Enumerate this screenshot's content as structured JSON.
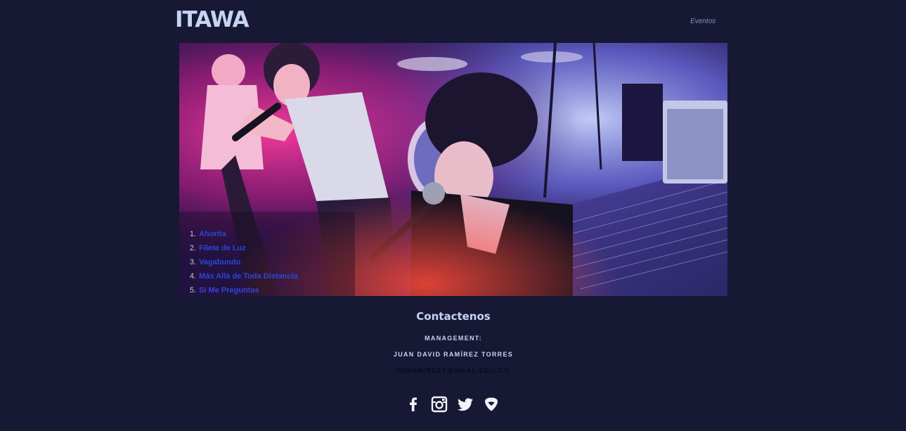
{
  "header": {
    "logo": "ITAWA",
    "nav": [
      {
        "label": "Eventos"
      }
    ]
  },
  "hero": {
    "tracks": [
      {
        "number": "1.",
        "title": "Ahorita"
      },
      {
        "number": "2.",
        "title": "Filete de Luz"
      },
      {
        "number": "3.",
        "title": "Vagabundo"
      },
      {
        "number": "4.",
        "title": "Más Allá de Toda Distancia"
      },
      {
        "number": "5.",
        "title": "Si Me Preguntas"
      }
    ]
  },
  "contact": {
    "title": "Contactenos",
    "management_label": "MANAGEMENT:",
    "manager_name": "JUAN DAVID RAMÍREZ TORRES",
    "email": "JDRAMIREZT@UNAL.EDU.CO"
  },
  "social": [
    {
      "icon": "facebook-icon"
    },
    {
      "icon": "instagram-icon"
    },
    {
      "icon": "twitter-icon"
    },
    {
      "icon": "guitar-pick-icon"
    }
  ],
  "colors": {
    "background": "#161834",
    "logo": "#c7d3f3",
    "track_link": "#2f45d8",
    "email": "#05060e"
  }
}
